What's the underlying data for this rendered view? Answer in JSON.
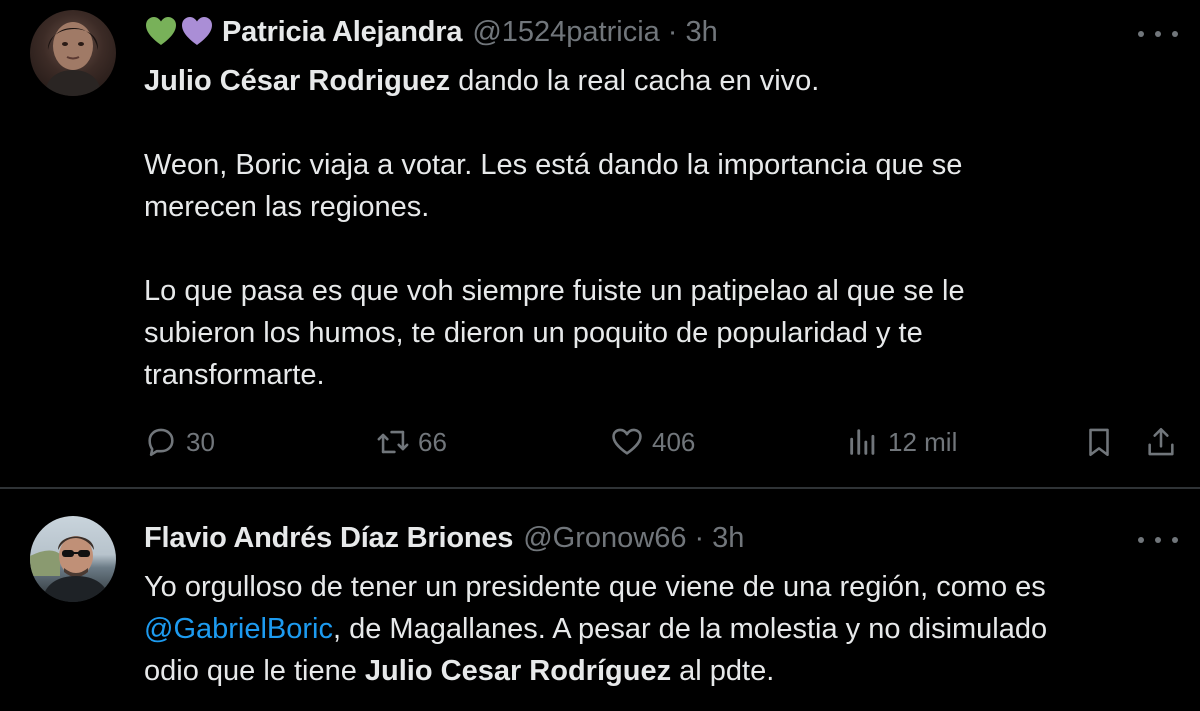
{
  "tweets": [
    {
      "author_name": "Patricia Alejandra",
      "handle": "@1524patricia",
      "separator": "·",
      "time": "3h",
      "name_emoji": [
        "green-heart",
        "purple-heart"
      ],
      "text": {
        "l1_bold": "Julio César Rodriguez",
        "l1_rest": " dando la real cacha en vivo.",
        "l2": "Weon, Boric viaja a votar. Les está dando la importancia que se",
        "l3": "merecen las regiones.",
        "l4": "Lo que pasa es que voh siempre fuiste un patipelao al que se le",
        "l5": "subieron los humos, te dieron un poquito de popularidad y te",
        "l6": "transformarte."
      },
      "stats": {
        "replies": "30",
        "reposts": "66",
        "likes": "406",
        "views": "12 mil"
      }
    },
    {
      "author_name": "Flavio Andrés Díaz Briones",
      "handle": "@Gronow66",
      "separator": "·",
      "time": "3h",
      "text": {
        "l1": "Yo orgulloso de tener un presidente que viene de una región, como es",
        "l2_mention": "@GabrielBoric",
        "l2_rest": ", de Magallanes. A pesar de la molestia y no disimulado",
        "l3_pre": "odio que le tiene ",
        "l3_bold": "Julio Cesar Rodríguez",
        "l3_post": " al pdte."
      }
    }
  ],
  "colors": {
    "background": "#000000",
    "text": "#e7e9ea",
    "muted": "#71767b",
    "mention": "#1d9bf0",
    "divider": "#2f3336",
    "green_heart": "#78b159",
    "purple_heart": "#aa8ed6"
  },
  "icons": [
    "reply-icon",
    "repost-icon",
    "like-icon",
    "views-icon",
    "bookmark-icon",
    "share-icon",
    "more-icon"
  ]
}
